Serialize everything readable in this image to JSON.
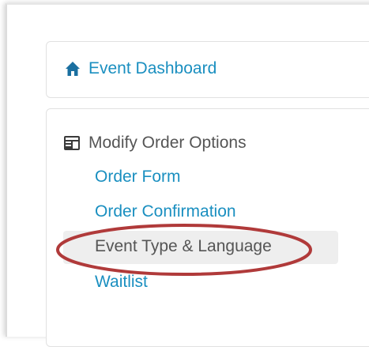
{
  "dashboard": {
    "icon": "home-icon",
    "label": "Event Dashboard"
  },
  "order_options": {
    "icon": "form-layout-icon",
    "header": "Modify Order Options",
    "items": [
      {
        "label": "Order Form",
        "active": false
      },
      {
        "label": "Order Confirmation",
        "active": false
      },
      {
        "label": "Event Type & Language",
        "active": true
      },
      {
        "label": "Waitlist",
        "active": false
      }
    ]
  },
  "annotation": {
    "shape": "ellipse",
    "color": "#b03a3a"
  },
  "colors": {
    "link": "#1a8fc0",
    "text": "#555555",
    "active_bg": "#eeeeee"
  }
}
